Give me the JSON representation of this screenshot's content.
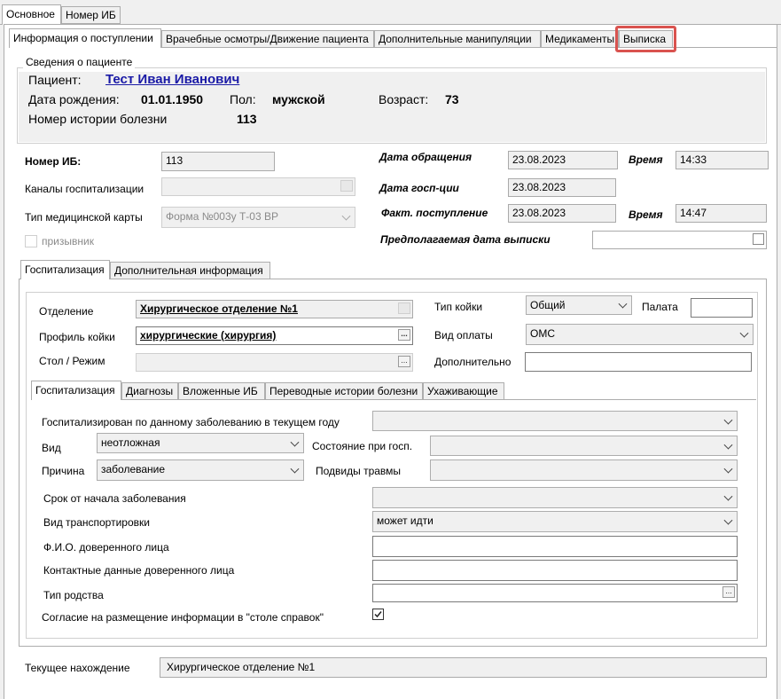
{
  "outer_tabs": [
    "Основное",
    "Номер ИБ"
  ],
  "inner_tabs": [
    "Информация о поступлении",
    "Врачебные осмотры/Движение пациента",
    "Дополнительные манипуляции",
    "Медикаменты",
    "Выписка"
  ],
  "patient_group": {
    "title": "Сведения о пациенте",
    "patient_label": "Пациент:",
    "patient_name": "Тест Иван Иванович",
    "dob_label": "Дата рождения:",
    "dob": "01.01.1950",
    "sex_label": "Пол:",
    "sex": "мужской",
    "age_label": "Возраст:",
    "age": "73",
    "history_label": "Номер истории болезни",
    "history": "113"
  },
  "form": {
    "ib_label": "Номер ИБ:",
    "ib_value": "113",
    "channels_label": "Каналы госпитализации",
    "card_type_label": "Тип медицинской карты",
    "card_type_value": "Форма №003у Т-03 ВР",
    "conscript_label": "призывник",
    "visit_date_label": "Дата обращения",
    "visit_date": "23.08.2023",
    "time_label": "Время",
    "visit_time": "14:33",
    "hosp_date_label": "Дата госп-ции",
    "hosp_date": "23.08.2023",
    "fact_label": "Факт. поступление",
    "fact_date": "23.08.2023",
    "time2_label": "Время",
    "fact_time": "14:47",
    "discharge_label": "Предполагаемая дата выписки"
  },
  "section_tabs": [
    "Госпитализация",
    "Дополнительная информация"
  ],
  "dept": {
    "dept_label": "Отделение",
    "dept_value": "Хирургическое отделение №1",
    "profile_label": "Профиль койки",
    "profile_value": "хирургические (хирургия)",
    "table_label": "Стол / Режим",
    "bed_type_label": "Тип койки",
    "bed_type_value": "Общий",
    "ward_label": "Палата",
    "pay_label": "Вид оплаты",
    "pay_value": "ОМС",
    "extra_label": "Дополнительно"
  },
  "sub_tabs": [
    "Госпитализация",
    "Диагнозы",
    "Вложенные ИБ",
    "Переводные истории болезни",
    "Ухаживающие"
  ],
  "hosp": {
    "this_year_label": "Госпитализирован по данному заболеванию в текущем году",
    "kind_label": "Вид",
    "kind_value": "неотложная",
    "state_label": "Состояние при госп.",
    "reason_label": "Причина",
    "reason_value": "заболевание",
    "trauma_label": "Подвиды травмы",
    "term_label": "Срок от начала заболевания",
    "transport_label": "Вид транспортировки",
    "transport_value": "может идти",
    "trustee_label": "Ф.И.О. доверенного лица",
    "contacts_label": "Контактные данные доверенного лица",
    "relation_label": "Тип родства",
    "consent_label": "Согласие на размещение информации в \"столе справок\"",
    "consent_checked": true
  },
  "current_location_label": "Текущее нахождение",
  "current_location_value": "Хирургическое отделение №1",
  "colors": {
    "highlight": "#d9534f",
    "link": "#1a1aa6",
    "group_bg": "#f0f0f0"
  }
}
